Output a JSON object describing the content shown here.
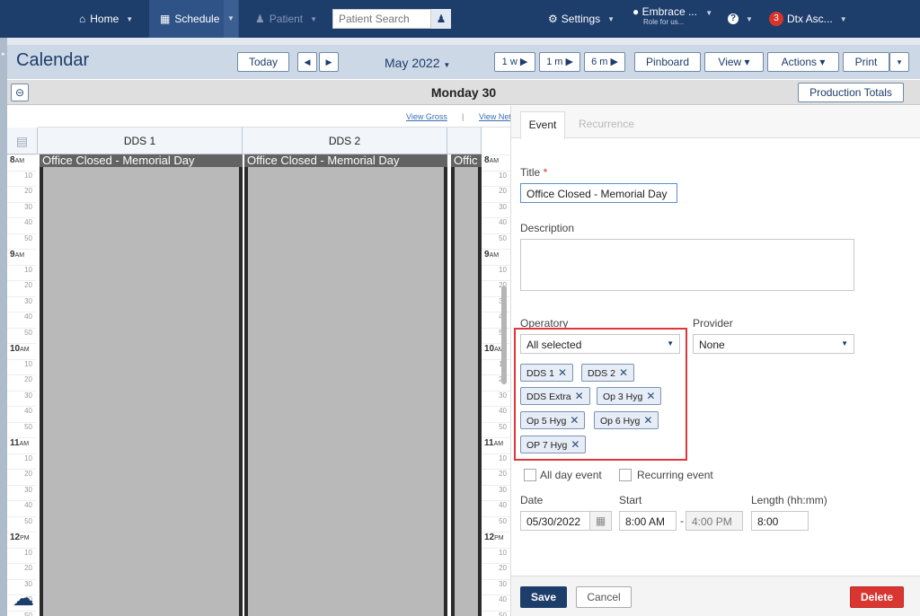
{
  "nav": {
    "home": "Home",
    "schedule": "Schedule",
    "patient": "Patient",
    "search_placeholder": "Patient Search",
    "settings": "Settings",
    "org_name": "Embrace ...",
    "org_role": "Role for us...",
    "help": "?",
    "notif_count": "3",
    "user": "Dtx Asc..."
  },
  "toolbar": {
    "title": "Calendar",
    "today": "Today",
    "prev": "◀",
    "next": "▶",
    "month": "May 2022",
    "range_1w": "1 w ▶",
    "range_1m": "1 m ▶",
    "range_6m": "6 m ▶",
    "pinboard": "Pinboard",
    "view": "View ▾",
    "actions": "Actions ▾",
    "print": "Print",
    "print_more": "▾"
  },
  "subbar": {
    "day_label": "Monday 30",
    "production_totals": "Production Totals"
  },
  "calendar": {
    "view_gross": "View Gross",
    "separator": "|",
    "view_net": "View Net",
    "columns": [
      "DDS 1",
      "DDS 2"
    ],
    "events": [
      "Office Closed - Memorial Day",
      "Office Closed - Memorial Day",
      "Offic"
    ],
    "hours": [
      {
        "hour": "8",
        "ampm": "AM"
      },
      {
        "hour": "9",
        "ampm": "AM"
      },
      {
        "hour": "10",
        "ampm": "AM"
      },
      {
        "hour": "11",
        "ampm": "AM"
      },
      {
        "hour": "12",
        "ampm": "PM"
      }
    ],
    "minutes": [
      "10",
      "20",
      "30",
      "40",
      "50"
    ]
  },
  "event_panel": {
    "tabs": [
      "Event",
      "Recurrence"
    ],
    "title_label": "Title",
    "title_required": "*",
    "title_value": "Office Closed - Memorial Day",
    "description_label": "Description",
    "operatory_label": "Operatory",
    "operatory_value": "All selected",
    "provider_label": "Provider",
    "provider_value": "None",
    "operatories": [
      "DDS 1",
      "DDS 2",
      "DDS Extra",
      "Op 3 Hyg",
      "Op 5 Hyg",
      "Op 6 Hyg",
      "OP 7 Hyg"
    ],
    "all_day_label": "All day event",
    "recurring_label": "Recurring event",
    "date_label": "Date",
    "date_value": "05/30/2022",
    "start_label": "Start",
    "start_value": "8:00 AM",
    "dash": "-",
    "end_value": "4:00 PM",
    "length_label": "Length (hh:mm)",
    "length_value": "8:00",
    "save": "Save",
    "cancel": "Cancel",
    "delete": "Delete"
  },
  "colors": {
    "navy": "#1d3d6b",
    "highlight": "#e0353a",
    "delete": "#d93632"
  }
}
